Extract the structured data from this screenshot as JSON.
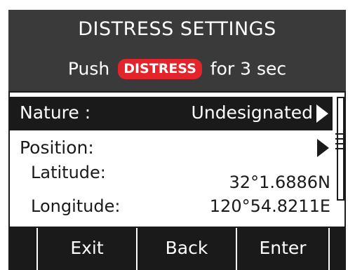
{
  "header": {
    "title": "DISTRESS SETTINGS",
    "instruction_prefix": "Push",
    "button_label": "DISTRESS",
    "instruction_suffix": "for 3 sec"
  },
  "settings": {
    "nature": {
      "label": "Nature :",
      "value": "Undesignated"
    },
    "position": {
      "label": "Position:",
      "latitude_label": "Latitude:",
      "latitude_value": "32°1.6886N",
      "longitude_label": "Longitude:",
      "longitude_value": "120°54.8211E"
    }
  },
  "softkeys": [
    {
      "label": ""
    },
    {
      "label": "Exit"
    },
    {
      "label": "Back"
    },
    {
      "label": "Enter"
    },
    {
      "label": ""
    }
  ],
  "colors": {
    "background": "#1a1a1a",
    "header": "#3a3a3a",
    "distress_badge": "#e3242b",
    "text_light": "#ffffff",
    "text_dark": "#1a1a1a"
  },
  "icons": {
    "nature_arrow": "triangle-right-icon",
    "position_arrow": "triangle-right-icon"
  }
}
